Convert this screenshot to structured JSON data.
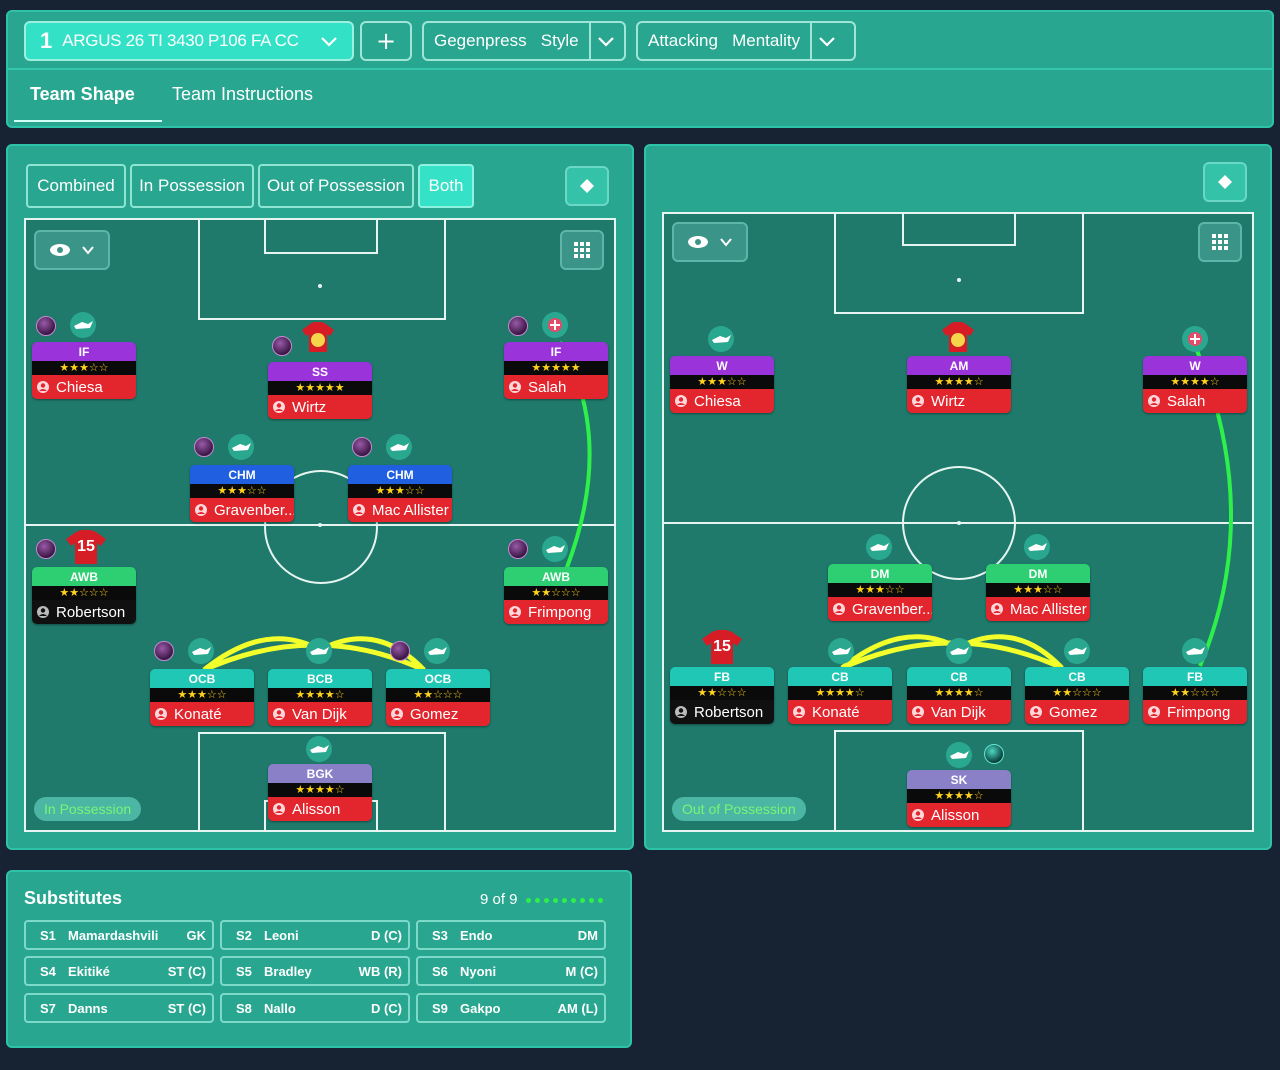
{
  "topbar": {
    "tactic_number": "1",
    "tactic_name": "ARGUS 26 TI 3430 P106 FA CC",
    "add_label": "+",
    "style_label": "Gegenpress",
    "style_suffix": "Style",
    "mentality_label": "Attacking",
    "mentality_suffix": "Mentality",
    "tabs": [
      "Team Shape",
      "Team Instructions"
    ]
  },
  "segments": [
    "Combined",
    "In Possession",
    "Out of Possession",
    "Both"
  ],
  "pitch_left": {
    "phase_label": "In Possession",
    "players": [
      {
        "role": "IF",
        "stars": "★★★☆☆",
        "name": "Chiesa"
      },
      {
        "role": "SS",
        "stars": "★★★★★",
        "name": "Wirtz"
      },
      {
        "role": "IF",
        "stars": "★★★★★",
        "name": "Salah"
      },
      {
        "role": "CHM",
        "stars": "★★★☆☆",
        "name": "Gravenber..."
      },
      {
        "role": "CHM",
        "stars": "★★★☆☆",
        "name": "Mac Allister"
      },
      {
        "role": "AWB",
        "stars": "★★☆☆☆",
        "name": "Robertson"
      },
      {
        "role": "AWB",
        "stars": "★★☆☆☆",
        "name": "Frimpong"
      },
      {
        "role": "OCB",
        "stars": "★★★☆☆",
        "name": "Konaté"
      },
      {
        "role": "BCB",
        "stars": "★★★★☆",
        "name": "Van Dijk"
      },
      {
        "role": "OCB",
        "stars": "★★☆☆☆",
        "name": "Gomez"
      },
      {
        "role": "BGK",
        "stars": "★★★★☆",
        "name": "Alisson"
      }
    ],
    "shirt_numbers": [
      "15"
    ]
  },
  "pitch_right": {
    "phase_label": "Out of Possession",
    "players": [
      {
        "role": "W",
        "stars": "★★★☆☆",
        "name": "Chiesa"
      },
      {
        "role": "AM",
        "stars": "★★★★☆",
        "name": "Wirtz"
      },
      {
        "role": "W",
        "stars": "★★★★☆",
        "name": "Salah"
      },
      {
        "role": "DM",
        "stars": "★★★☆☆",
        "name": "Gravenber..."
      },
      {
        "role": "DM",
        "stars": "★★★☆☆",
        "name": "Mac Allister"
      },
      {
        "role": "FB",
        "stars": "★★☆☆☆",
        "name": "Robertson"
      },
      {
        "role": "CB",
        "stars": "★★★★☆",
        "name": "Konaté"
      },
      {
        "role": "CB",
        "stars": "★★★★☆",
        "name": "Van Dijk"
      },
      {
        "role": "CB",
        "stars": "★★☆☆☆",
        "name": "Gomez"
      },
      {
        "role": "FB",
        "stars": "★★☆☆☆",
        "name": "Frimpong"
      },
      {
        "role": "SK",
        "stars": "★★★★☆",
        "name": "Alisson"
      }
    ],
    "shirt_numbers": [
      "15"
    ]
  },
  "substitutes": {
    "title": "Substitutes",
    "count": "9 of 9",
    "items": [
      {
        "slot": "S1",
        "name": "Mamardashvili",
        "pos": "GK"
      },
      {
        "slot": "S2",
        "name": "Leoni",
        "pos": "D (C)"
      },
      {
        "slot": "S3",
        "name": "Endo",
        "pos": "DM"
      },
      {
        "slot": "S4",
        "name": "Ekitiké",
        "pos": "ST (C)"
      },
      {
        "slot": "S5",
        "name": "Bradley",
        "pos": "WB (R)"
      },
      {
        "slot": "S6",
        "name": "Nyoni",
        "pos": "M (C)"
      },
      {
        "slot": "S7",
        "name": "Danns",
        "pos": "ST (C)"
      },
      {
        "slot": "S8",
        "name": "Nallo",
        "pos": "D (C)"
      },
      {
        "slot": "S9",
        "name": "Gakpo",
        "pos": "AM (L)"
      }
    ]
  },
  "colors": {
    "panel": "#28a690",
    "pitch": "#1f7a6c",
    "accent": "#35e2c8",
    "name_bar": "#e3262e"
  }
}
